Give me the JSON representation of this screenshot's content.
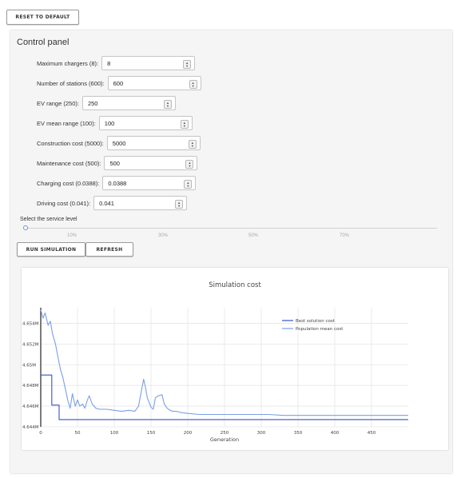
{
  "header": {
    "reset_label": "RESET TO DEFAULT"
  },
  "panel": {
    "title": "Control panel",
    "fields": [
      {
        "label": "Maximum chargers (8):",
        "value": "8"
      },
      {
        "label": "Number of stations (600):",
        "value": "600"
      },
      {
        "label": "EV range (250):",
        "value": "250"
      },
      {
        "label": "EV mean range (100):",
        "value": "100"
      },
      {
        "label": "Construction cost (5000):",
        "value": "5000"
      },
      {
        "label": "Maintenance cost (500):",
        "value": "500"
      },
      {
        "label": "Charging cost (0.0388):",
        "value": "0.0388"
      },
      {
        "label": "Driving cost (0.041):",
        "value": "0.041"
      }
    ],
    "service": {
      "label": "Select the service level",
      "value_fraction": 0.0,
      "ticks": [
        "10%",
        "30%",
        "50%",
        "70%"
      ]
    },
    "run_label": "RUN SIMULATION",
    "refresh_label": "REFRESH"
  },
  "chart_data": {
    "type": "line",
    "title": "Simulation cost",
    "xlabel": "Generation",
    "ylabel": "",
    "xlim": [
      0,
      500
    ],
    "ylim": [
      4.644,
      4.6555
    ],
    "x_ticks": [
      0,
      50,
      100,
      150,
      200,
      250,
      300,
      350,
      400,
      450
    ],
    "y_ticks": [
      {
        "value": 4.644,
        "label": "4.644M"
      },
      {
        "value": 4.646,
        "label": "4.646M"
      },
      {
        "value": 4.648,
        "label": "4.648M"
      },
      {
        "value": 4.65,
        "label": "4.65M"
      },
      {
        "value": 4.652,
        "label": "4.652M"
      },
      {
        "value": 4.654,
        "label": "4.654M"
      }
    ],
    "grid": true,
    "legend": "top-right",
    "colors": {
      "best": "#3b50c8",
      "mean": "#7b9fe6"
    },
    "series": [
      {
        "name": "Best solution cost",
        "x": [
          0,
          15,
          15,
          25,
          25,
          500
        ],
        "y": [
          4.649,
          4.649,
          4.6461,
          4.6461,
          4.6447,
          4.6447
        ]
      },
      {
        "name": "Population mean cost",
        "x": [
          0,
          3,
          6,
          10,
          13,
          16,
          20,
          24,
          27,
          30,
          34,
          37,
          40,
          43,
          47,
          50,
          53,
          57,
          60,
          63,
          66,
          70,
          75,
          80,
          90,
          100,
          110,
          120,
          128,
          133,
          137,
          140,
          142,
          145,
          150,
          153,
          156,
          160,
          165,
          168,
          172,
          176,
          180,
          185,
          190,
          200,
          215,
          230,
          250,
          270,
          290,
          310,
          330,
          350,
          370,
          390,
          410,
          430,
          450,
          470,
          490,
          500
        ],
        "y": [
          4.6553,
          4.6545,
          4.655,
          4.6538,
          4.6542,
          4.653,
          4.652,
          4.6505,
          4.6495,
          4.6488,
          4.6475,
          4.6465,
          4.6458,
          4.6472,
          4.646,
          4.6466,
          4.646,
          4.6462,
          4.6458,
          4.6465,
          4.647,
          4.6462,
          4.6458,
          4.6457,
          4.6457,
          4.6456,
          4.6455,
          4.6456,
          4.6455,
          4.646,
          4.6475,
          4.6486,
          4.648,
          4.6468,
          4.6459,
          4.6457,
          4.6468,
          4.647,
          4.6471,
          4.6462,
          4.6458,
          4.6456,
          4.6455,
          4.6455,
          4.6454,
          4.6453,
          4.6452,
          4.6452,
          4.6452,
          4.6452,
          4.6452,
          4.6452,
          4.6451,
          4.6451,
          4.6451,
          4.6451,
          4.6451,
          4.6451,
          4.6451,
          4.6451,
          4.6451,
          4.6451
        ]
      }
    ]
  }
}
